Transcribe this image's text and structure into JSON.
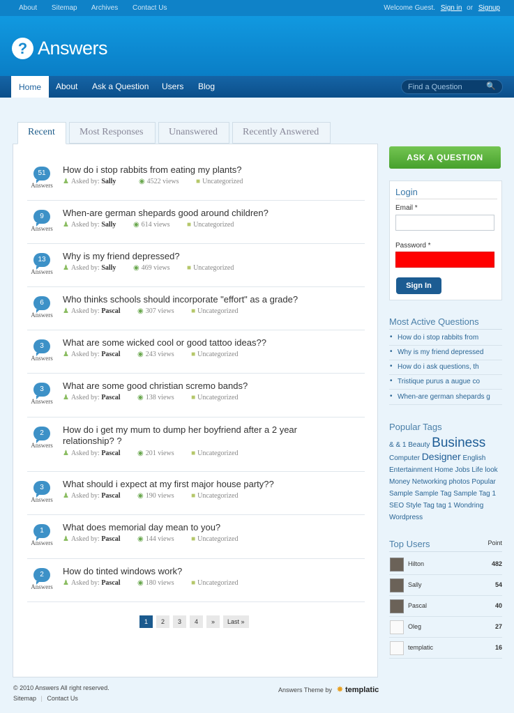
{
  "topbar": {
    "links": [
      "About",
      "Sitemap",
      "Archives",
      "Contact Us"
    ],
    "welcome": "Welcome Guest.",
    "signin": "Sign in",
    "or": "or",
    "signup": "Signup"
  },
  "header": {
    "logo_glyph": "?",
    "site_name": "Answers"
  },
  "nav": {
    "items": [
      "Home",
      "About",
      "Ask a Question",
      "Users",
      "Blog"
    ],
    "search_placeholder": "Find a Question"
  },
  "tabs": [
    "Recent",
    "Most Responses",
    "Unanswered",
    "Recently Answered"
  ],
  "questions": [
    {
      "count": "51",
      "title": "How do i stop rabbits from eating my plants?",
      "author": "Sally",
      "views": "4522 views",
      "category": "Uncategorized"
    },
    {
      "count": "9",
      "title": "When-are german shepards good around children?",
      "author": "Sally",
      "views": "614 views",
      "category": "Uncategorized"
    },
    {
      "count": "13",
      "title": "Why is my friend depressed?",
      "author": "Sally",
      "views": "469 views",
      "category": "Uncategorized"
    },
    {
      "count": "6",
      "title": "Who thinks schools should incorporate \"effort\" as a grade?",
      "author": "Pascal",
      "views": "307 views",
      "category": "Uncategorized"
    },
    {
      "count": "3",
      "title": "What are some wicked cool or good tattoo ideas??",
      "author": "Pascal",
      "views": "243 views",
      "category": "Uncategorized"
    },
    {
      "count": "3",
      "title": "What are some good christian scremo bands?",
      "author": "Pascal",
      "views": "138 views",
      "category": "Uncategorized"
    },
    {
      "count": "2",
      "title": "How do i get my mum to dump her boyfriend after a 2 year relationship? ?",
      "author": "Pascal",
      "views": "201 views",
      "category": "Uncategorized"
    },
    {
      "count": "3",
      "title": "What should i expect at my first major house party??",
      "author": "Pascal",
      "views": "190 views",
      "category": "Uncategorized"
    },
    {
      "count": "1",
      "title": "What does memorial day mean to you?",
      "author": "Pascal",
      "views": "144 views",
      "category": "Uncategorized"
    },
    {
      "count": "2",
      "title": "How do tinted windows work?",
      "author": "Pascal",
      "views": "180 views",
      "category": "Uncategorized"
    }
  ],
  "answers_label": "Answers",
  "asked_by_label": "Asked by:",
  "pagination": [
    "1",
    "2",
    "3",
    "4",
    "»",
    "Last »"
  ],
  "sidebar": {
    "ask_button": "ASK A QUESTION",
    "login": {
      "title": "Login",
      "email_label": "Email *",
      "password_label": "Password *",
      "signin_button": "Sign In"
    },
    "most_active_title": "Most Active Questions",
    "most_active": [
      "How do i stop rabbits from",
      "Why is my friend depressed",
      "How do i ask questions, th",
      "Tristique purus a augue co",
      "When-are german shepards g"
    ],
    "popular_tags_title": "Popular Tags",
    "tags": {
      "t1": "& & 1 Beauty",
      "big1": "Business",
      "t2": "Computer",
      "big2": "Designer",
      "t3": "English Entertainment Home Jobs Life look Money Networking photos Popular Sample Sample Tag Sample Tag 1 SEO Style Tag tag 1 Wondring Wordpress"
    },
    "top_users_title": "Top Users",
    "point_label": "Point",
    "users": [
      {
        "name": "Hilton",
        "points": "482"
      },
      {
        "name": "Sally",
        "points": "54"
      },
      {
        "name": "Pascal",
        "points": "40"
      },
      {
        "name": "Oleg",
        "points": "27"
      },
      {
        "name": "templatic",
        "points": "16"
      }
    ]
  },
  "footer": {
    "copyright": "© 2010 Answers All right reserved.",
    "links": [
      "Sitemap",
      "Contact Us"
    ],
    "theme_by": "Answers Theme by",
    "brand": "templatic"
  },
  "colors": {
    "accent": "#0f82c8",
    "nav": "#0b4f8a",
    "ask_green": "#46a02c",
    "password_field": "#ff0000"
  }
}
